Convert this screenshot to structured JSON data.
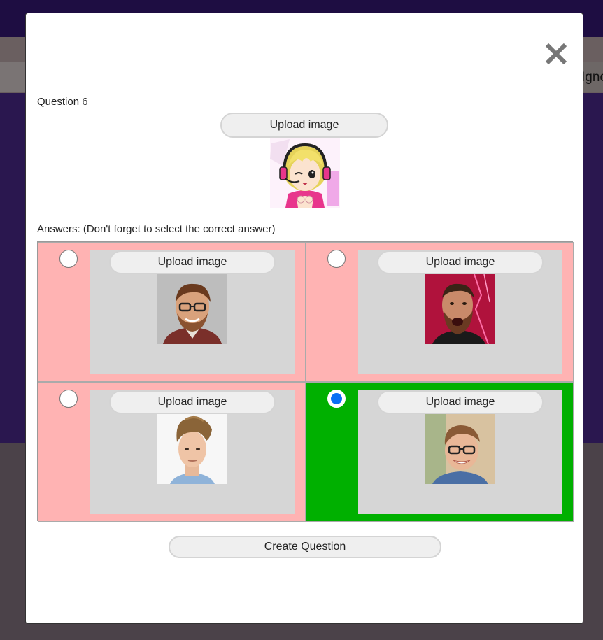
{
  "background": {
    "partial_button_text": "Ignc"
  },
  "modal": {
    "close_symbol": "✕",
    "question_label": "Question 6",
    "question_upload_label": "Upload image",
    "answers_label": "Answers: (Don't forget to select the correct answer)",
    "answers": [
      {
        "upload_label": "Upload image",
        "selected": false,
        "avatar": "bearded-man-glasses",
        "color": "#ffb3b3"
      },
      {
        "upload_label": "Upload image",
        "selected": false,
        "avatar": "footballer-red-background",
        "color": "#ffb3b3"
      },
      {
        "upload_label": "Upload image",
        "selected": false,
        "avatar": "young-man-hair-up",
        "color": "#ffb3b3"
      },
      {
        "upload_label": "Upload image",
        "selected": true,
        "avatar": "smiling-man-glasses",
        "color": "#00b000"
      }
    ],
    "create_button_label": "Create Question"
  },
  "colors": {
    "modal_bg": "#ffffff",
    "answer_unselected": "#ffb3b3",
    "answer_selected": "#00b000",
    "radio_selected": "#0a6ff5",
    "background_purple": "#2a174f"
  }
}
